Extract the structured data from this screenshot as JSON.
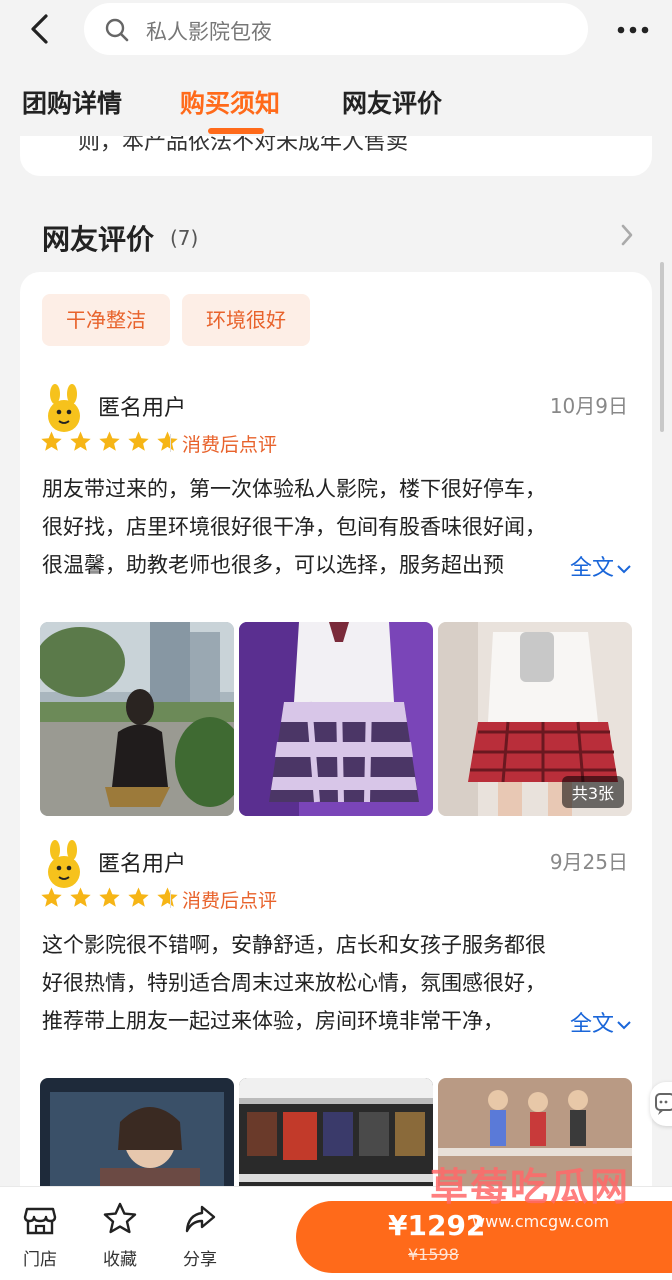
{
  "header": {
    "search_placeholder": "私人影院包夜"
  },
  "tabs": [
    {
      "label": "团购详情",
      "active": false
    },
    {
      "label": "购买须知",
      "active": true
    },
    {
      "label": "网友评价",
      "active": false
    }
  ],
  "notice_partial_text": "则，本产品依法不对未成年人售卖",
  "reviews_section": {
    "title": "网友评价",
    "count": "(7)",
    "tags": [
      "干净整洁",
      "环境很好"
    ]
  },
  "reviews": [
    {
      "user": "匿名用户",
      "date": "10月9日",
      "rating": 5,
      "post_tag": "消费后点评",
      "lines": [
        "朋友带过来的，第一次体验私人影院，楼下很好停车，",
        "很好找，店里环境很好很干净，包间有股香味很好闻，",
        "很温馨，助教老师也很多，可以选择，服务超出预"
      ],
      "full_text_label": "全文",
      "photo_count_label": "共3张"
    },
    {
      "user": "匿名用户",
      "date": "9月25日",
      "rating": 5,
      "post_tag": "消费后点评",
      "lines": [
        "这个影院很不错啊，安静舒适，店长和女孩子服务都很",
        "好很热情，特别适合周末过来放松心情，氛围感很好，",
        "推荐带上朋友一起过来体验，房间环境非常干净，"
      ],
      "full_text_label": "全文"
    }
  ],
  "bottom_bar": {
    "store_label": "门店",
    "favorite_label": "收藏",
    "share_label": "分享",
    "price": "¥1292",
    "original_price": "¥1598"
  },
  "watermark": {
    "title": "草莓吃瓜网",
    "url": "www.cmcgw.com"
  },
  "colors": {
    "accent": "#ff6a1a",
    "link": "#1a66d9",
    "star": "#f6b516"
  }
}
